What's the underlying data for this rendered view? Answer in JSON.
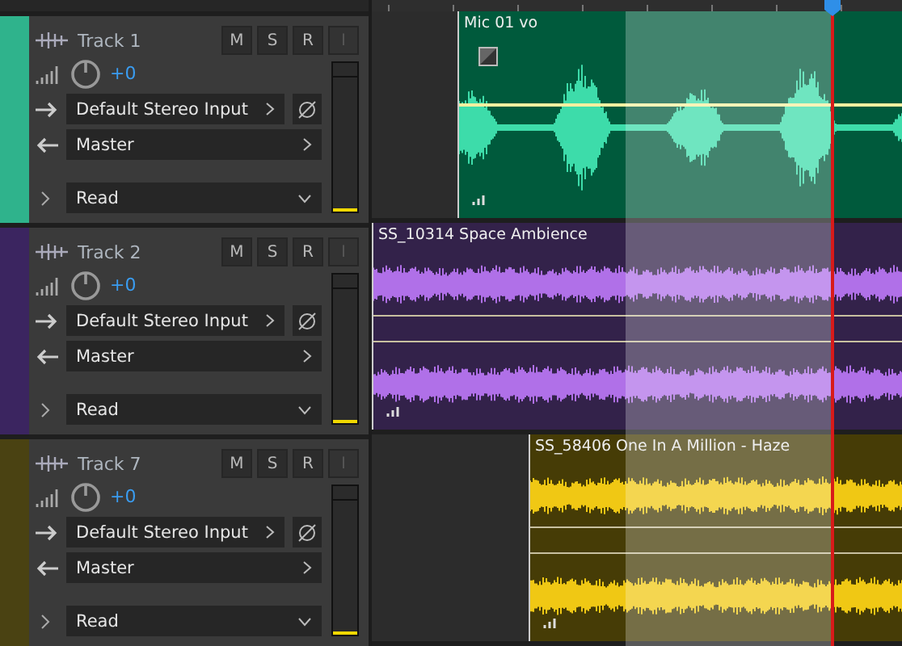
{
  "tracks": [
    {
      "name": "Track 1",
      "color": "#2fb38c",
      "pan": "+0",
      "input": "Default Stereo Input",
      "output": "Master",
      "automation": "Read",
      "buttons": [
        {
          "label": "M",
          "disabled": false
        },
        {
          "label": "S",
          "disabled": false
        },
        {
          "label": "R",
          "disabled": false
        },
        {
          "label": "I",
          "disabled": true
        }
      ],
      "clip": {
        "name": "Mic 01 vo",
        "kind": "mono"
      }
    },
    {
      "name": "Track 2",
      "color": "#3b2560",
      "pan": "+0",
      "input": "Default Stereo Input",
      "output": "Master",
      "automation": "Read",
      "buttons": [
        {
          "label": "M",
          "disabled": false
        },
        {
          "label": "S",
          "disabled": false
        },
        {
          "label": "R",
          "disabled": false
        },
        {
          "label": "I",
          "disabled": true
        }
      ],
      "clip": {
        "name": "SS_10314 Space Ambience",
        "kind": "stereo"
      }
    },
    {
      "name": "Track 7",
      "color": "#4a4212",
      "pan": "+0",
      "input": "Default Stereo Input",
      "output": "Master",
      "automation": "Read",
      "buttons": [
        {
          "label": "M",
          "disabled": false
        },
        {
          "label": "S",
          "disabled": false
        },
        {
          "label": "R",
          "disabled": false
        },
        {
          "label": "I",
          "disabled": true
        }
      ],
      "clip": {
        "name": "SS_58406 One In A Million - Haze",
        "kind": "stereo"
      }
    }
  ]
}
